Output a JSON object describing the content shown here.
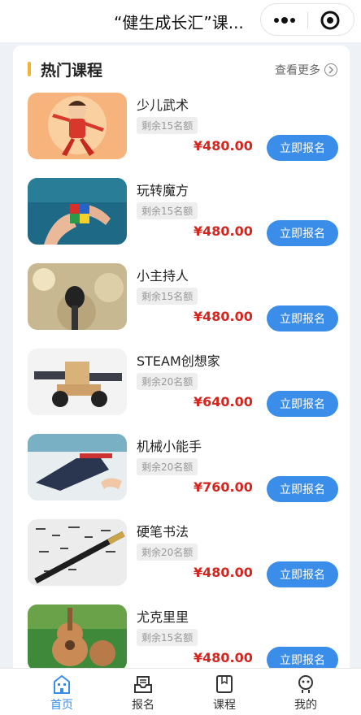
{
  "nav": {
    "title": "“健生成长汇”课...",
    "more_icon": "more-dots-icon",
    "close_icon": "record-close-icon"
  },
  "section": {
    "title": "热门课程",
    "see_more": "查看更多",
    "accent_color": "#f2b332"
  },
  "courses": [
    {
      "name": "少儿武术",
      "badge": "剩余15名额",
      "price": "¥480.00",
      "button": "立即报名"
    },
    {
      "name": "玩转魔方",
      "badge": "剩余15名额",
      "price": "¥480.00",
      "button": "立即报名"
    },
    {
      "name": "小主持人",
      "badge": "剩余15名额",
      "price": "¥480.00",
      "button": "立即报名"
    },
    {
      "name": "STEAM创想家",
      "badge": "剩余20名额",
      "price": "¥640.00",
      "button": "立即报名"
    },
    {
      "name": "机械小能手",
      "badge": "剩余20名额",
      "price": "¥760.00",
      "button": "立即报名"
    },
    {
      "name": "硬笔书法",
      "badge": "剩余20名额",
      "price": "¥480.00",
      "button": "立即报名"
    },
    {
      "name": "尤克里里",
      "badge": "剩余15名额",
      "price": "¥480.00",
      "button": "立即报名"
    }
  ],
  "tabbar": {
    "items": [
      {
        "label": "首页",
        "icon": "home-building-icon",
        "active": true
      },
      {
        "label": "报名",
        "icon": "signup-tray-icon",
        "active": false
      },
      {
        "label": "课程",
        "icon": "course-book-icon",
        "active": false
      },
      {
        "label": "我的",
        "icon": "profile-robot-icon",
        "active": false
      }
    ]
  },
  "colors": {
    "primary": "#3a8eea",
    "price": "#d4261e",
    "background": "#eef1f6"
  }
}
